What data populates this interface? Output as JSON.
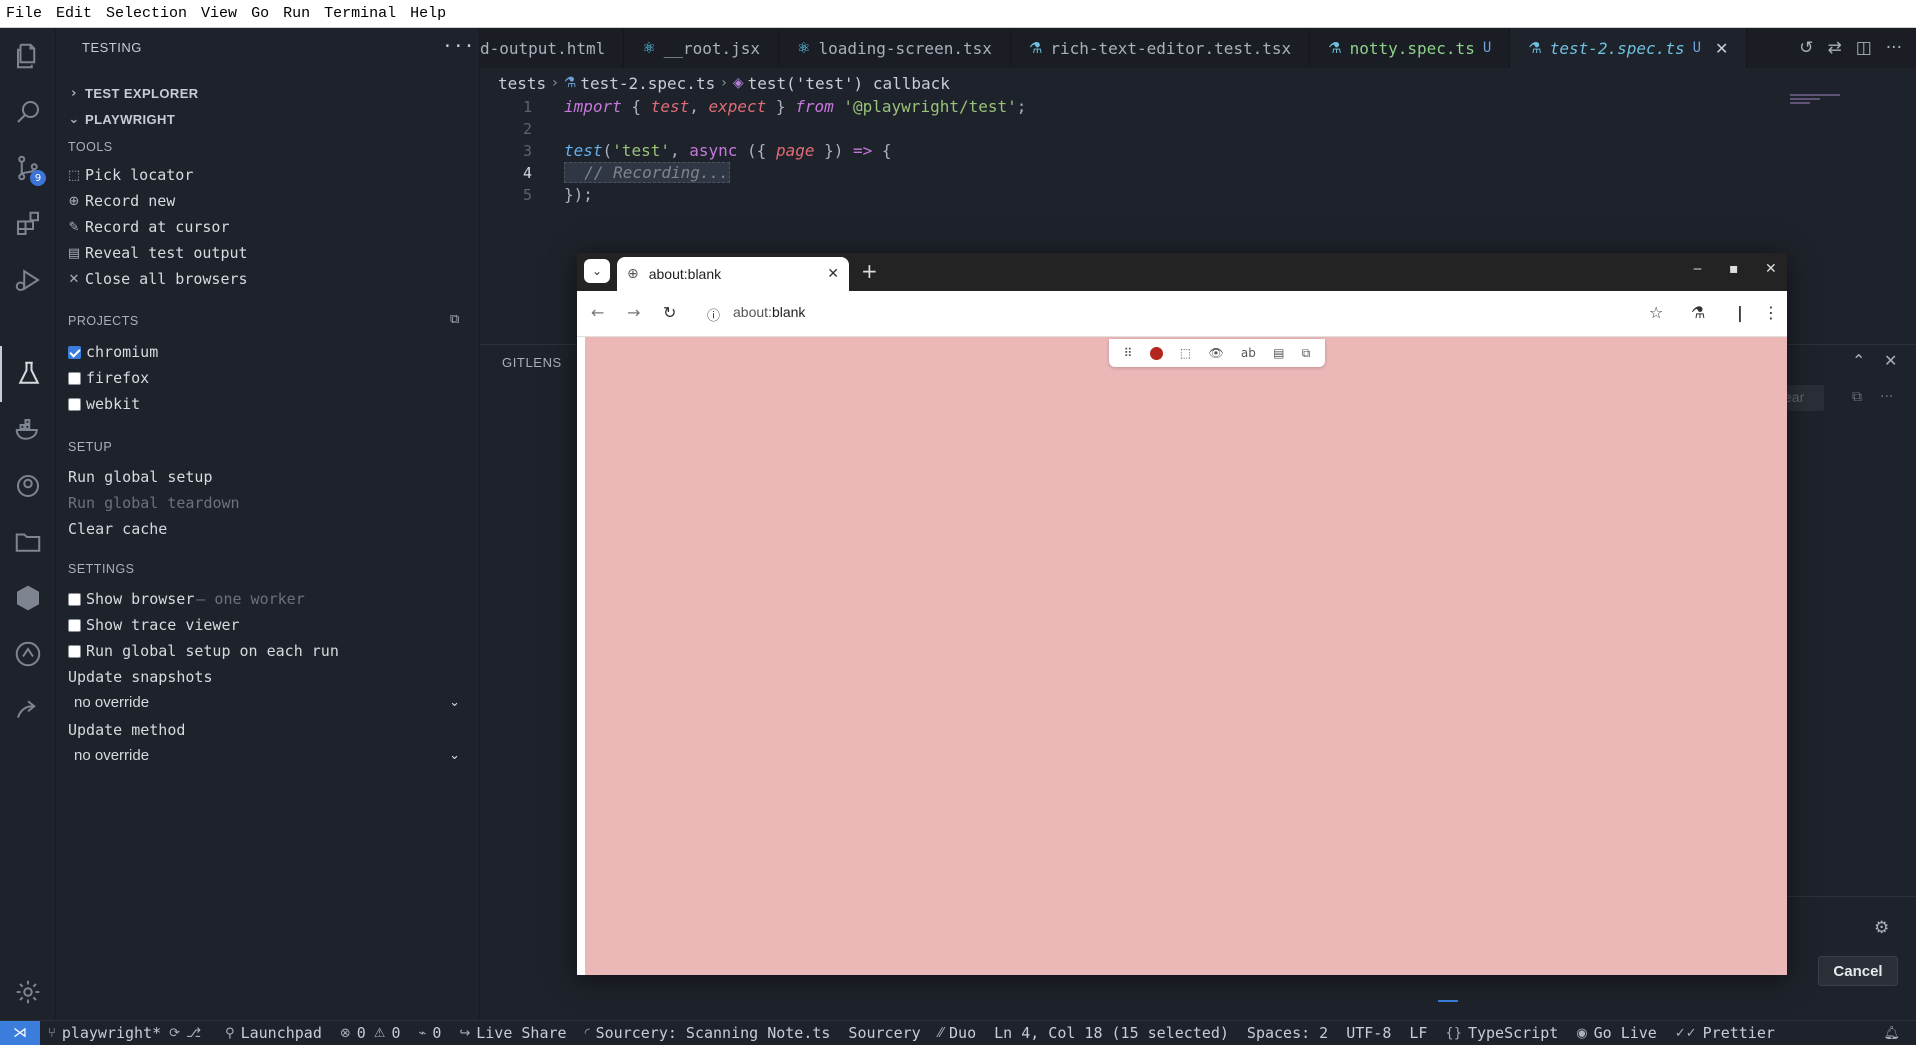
{
  "menu": [
    "File",
    "Edit",
    "Selection",
    "View",
    "Go",
    "Run",
    "Terminal",
    "Help"
  ],
  "activity_bar": {
    "source_control_badge": "9"
  },
  "sidebar": {
    "title": "TESTING",
    "test_explorer": "TEST EXPLORER",
    "playwright": "PLAYWRIGHT",
    "tools_header": "TOOLS",
    "tools": [
      "Pick locator",
      "Record new",
      "Record at cursor",
      "Reveal test output",
      "Close all browsers"
    ],
    "projects_header": "PROJECTS",
    "projects": [
      {
        "name": "chromium",
        "checked": true
      },
      {
        "name": "firefox",
        "checked": false
      },
      {
        "name": "webkit",
        "checked": false
      }
    ],
    "setup_header": "SETUP",
    "setup": [
      "Run global setup",
      "Run global teardown",
      "Clear cache"
    ],
    "settings_header": "SETTINGS",
    "show_browser": "Show browser",
    "show_browser_hint": "— one worker",
    "show_trace": "Show trace viewer",
    "run_global_each": "Run global setup on each run",
    "update_snapshots_label": "Update snapshots",
    "update_snapshots_value": "no override",
    "update_method_label": "Update method",
    "update_method_value": "no override"
  },
  "tabs": [
    {
      "label": "d-output.html",
      "active": false
    },
    {
      "label": "__root.jsx",
      "active": false
    },
    {
      "label": "loading-screen.tsx",
      "active": false
    },
    {
      "label": "rich-text-editor.test.tsx",
      "active": false
    },
    {
      "label": "notty.spec.ts",
      "status": "U",
      "active": false
    },
    {
      "label": "test-2.spec.ts",
      "status": "U",
      "active": true
    }
  ],
  "breadcrumb": {
    "folder": "tests",
    "file": "test-2.spec.ts",
    "symbol": "test('test') callback"
  },
  "editor": {
    "line_numbers": [
      "1",
      "2",
      "3",
      "4",
      "5"
    ],
    "current_line": "4"
  },
  "panel": {
    "title": "GITLENS",
    "clear_label": "ear"
  },
  "browser": {
    "tab_title": "about:blank",
    "url_scheme": "about:",
    "url_path": "blank",
    "recorder_color": "#b3261e"
  },
  "dialog": {
    "cancel_label": "Cancel"
  },
  "statusbar": {
    "branch": "playwright*",
    "launchpad": "Launchpad",
    "errors": "0",
    "warnings": "0",
    "ports": "0",
    "live_share": "Live Share",
    "sourcery_scan": "Sourcery: Scanning Note.ts",
    "sourcery": "Sourcery",
    "duo": "Duo",
    "cursor": "Ln 4, Col 18 (15 selected)",
    "spaces": "Spaces: 2",
    "encoding": "UTF-8",
    "eol": "LF",
    "language": "TypeScript",
    "go_live": "Go Live",
    "prettier": "Prettier"
  },
  "colors": {
    "accent": "#3b7ddd",
    "active_tab": "#6fc1e0",
    "browser_page": "#ebb7b7"
  }
}
